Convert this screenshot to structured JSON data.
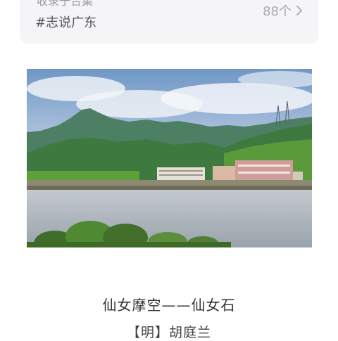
{
  "topic": {
    "upper_text": "收录于合集",
    "tag": "#志说广东",
    "count": "88个",
    "chevron_icon": "chevron-right-icon"
  },
  "photo": {
    "icon": "landscape-photo"
  },
  "article": {
    "title": "仙女摩空——仙女石",
    "author": "【明】胡庭兰"
  },
  "colors": {
    "card_bg": "#f5f5f7",
    "muted_text": "#9a9aa0",
    "tag_text": "#55565b",
    "title_text": "#333333"
  }
}
